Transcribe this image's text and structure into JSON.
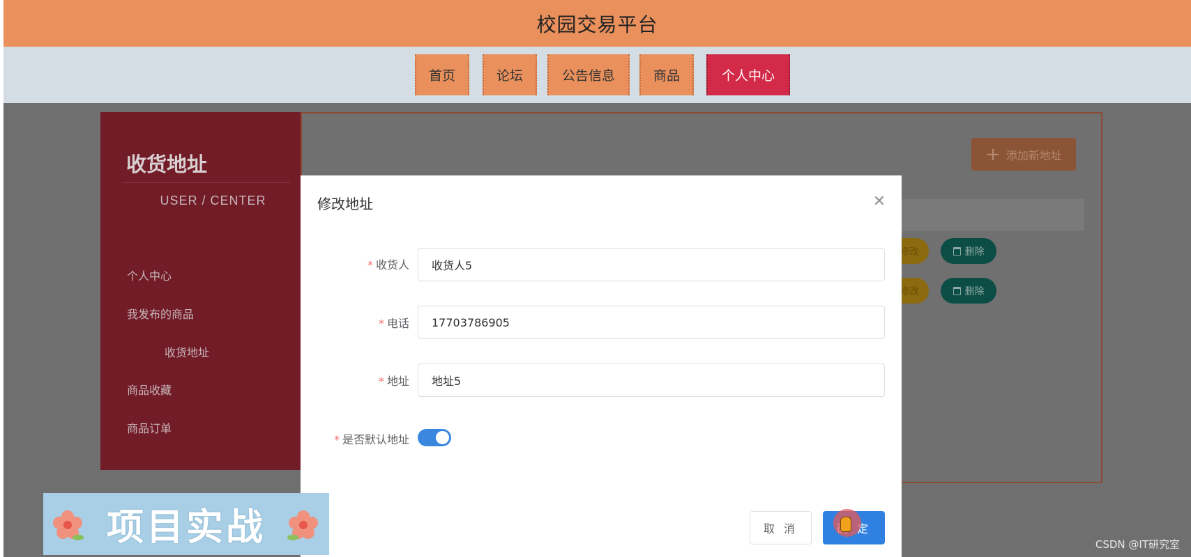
{
  "header": {
    "title": "校园交易平台"
  },
  "nav": {
    "items": [
      {
        "label": "首页"
      },
      {
        "label": "论坛"
      },
      {
        "label": "公告信息"
      },
      {
        "label": "商品"
      },
      {
        "label": "个人中心",
        "active": true
      }
    ]
  },
  "sidebar": {
    "title": "收货地址",
    "subtitle": "USER / CENTER",
    "links": [
      {
        "label": "个人中心"
      },
      {
        "label": "我发布的商品"
      },
      {
        "label": "收货地址",
        "active": true
      },
      {
        "label": "商品收藏"
      },
      {
        "label": "商品订单"
      }
    ]
  },
  "main": {
    "add_button": "添加新地址",
    "rows": [
      {
        "edit": "修改",
        "delete": "删除"
      },
      {
        "edit": "修改",
        "delete": "删除"
      }
    ]
  },
  "dialog": {
    "title": "修改地址",
    "close_icon": "close-icon",
    "fields": {
      "recipient": {
        "label": "收货人",
        "value": "收货人5"
      },
      "phone": {
        "label": "电话",
        "value": "17703786905"
      },
      "address": {
        "label": "地址",
        "value": "地址5"
      },
      "is_default": {
        "label": "是否默认地址",
        "value": true
      }
    },
    "required_mark": "*",
    "cancel": "取 消",
    "ok": "确 定"
  },
  "promo": {
    "text": "项目实战"
  },
  "watermark": "CSDN @IT研究室",
  "colors": {
    "header": "#e9905c",
    "nav_active": "#d22a48",
    "sidebar": "#721c28",
    "primary": "#2f80e0"
  }
}
